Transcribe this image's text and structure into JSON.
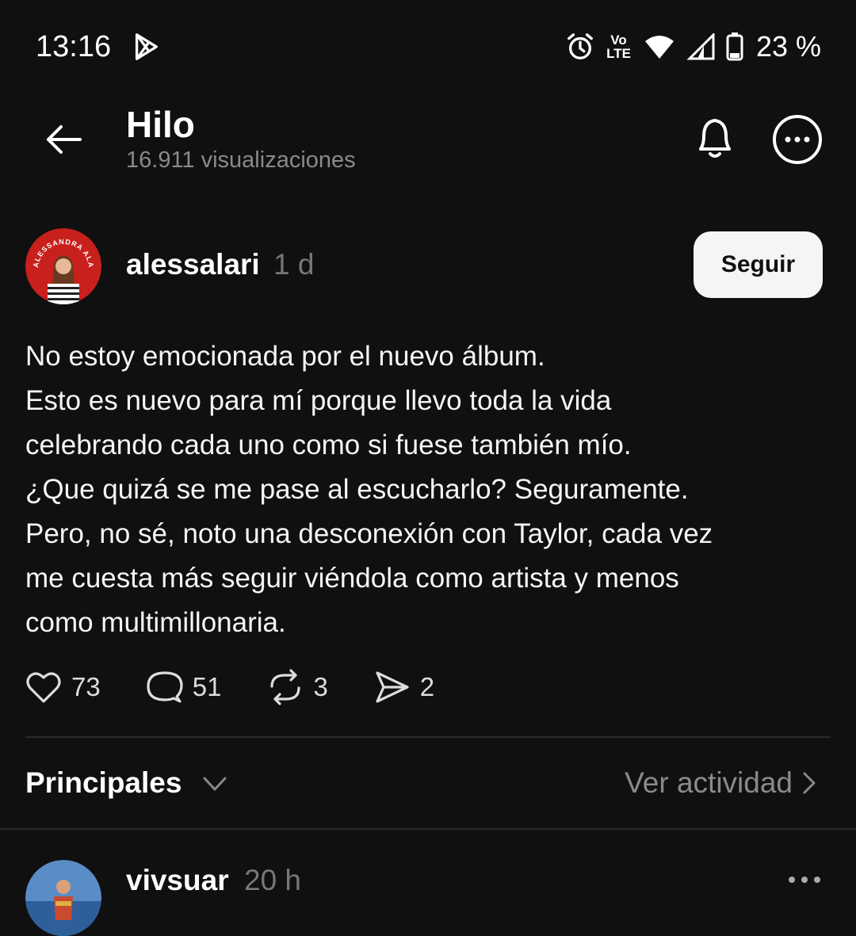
{
  "status_bar": {
    "time": "13:16",
    "battery": "23 %",
    "icons": [
      "play-store-icon",
      "alarm-icon",
      "volte-icon",
      "wifi-icon",
      "signal-icon",
      "battery-icon"
    ],
    "volte_top": "Vo",
    "volte_bottom": "LTE"
  },
  "header": {
    "title": "Hilo",
    "views": "16.911 visualizaciones",
    "icons": [
      "back-arrow-icon",
      "bell-icon",
      "more-circle-icon"
    ]
  },
  "post": {
    "username": "alessalari",
    "time": "1 d",
    "follow_label": "Seguir",
    "avatar_text": "ALESSANDRA ALARI",
    "avatar_color": "#c8201c",
    "lines": [
      "No estoy emocionada por el nuevo álbum.",
      "Esto es nuevo para mí porque llevo toda la vida",
      "celebrando cada uno como si fuese también mío.",
      "¿Que quizá se me pase al escucharlo? Seguramente.",
      "Pero, no sé, noto una desconexión con Taylor, cada vez",
      "me cuesta más seguir viéndola como artista y menos",
      "como multimillonaria."
    ],
    "actions": [
      {
        "name": "like",
        "icon": "heart-icon",
        "count": "73"
      },
      {
        "name": "reply",
        "icon": "comment-icon",
        "count": "51"
      },
      {
        "name": "repost",
        "icon": "repost-icon",
        "count": "3"
      },
      {
        "name": "share",
        "icon": "send-icon",
        "count": "2"
      }
    ]
  },
  "sort": {
    "label": "Principales",
    "activity_label": "Ver actividad"
  },
  "reply": {
    "username": "vivsuar",
    "time": "20 h"
  }
}
